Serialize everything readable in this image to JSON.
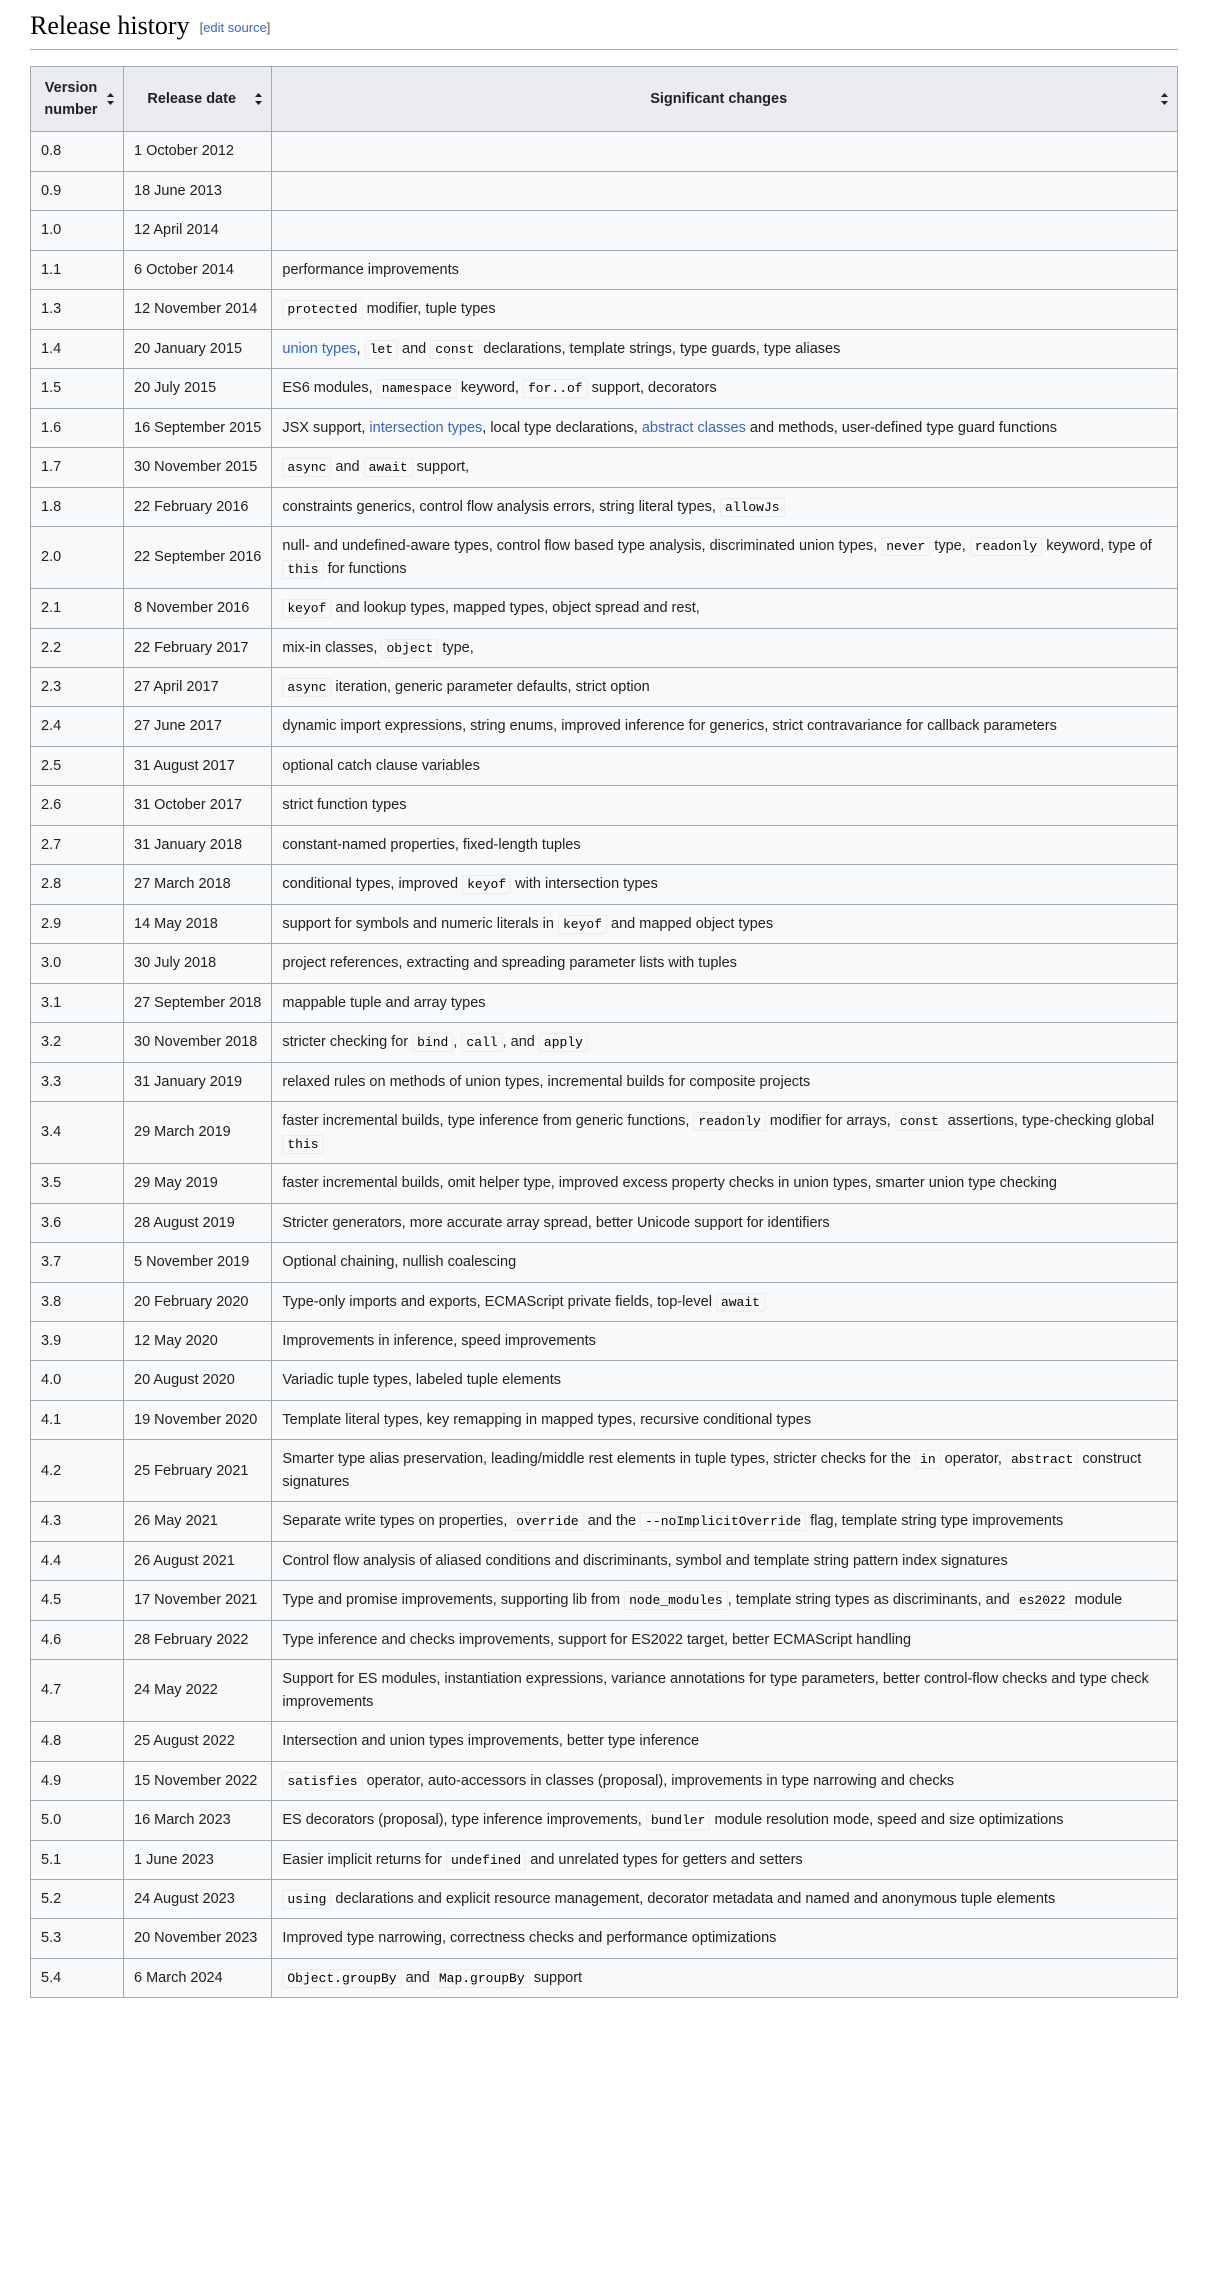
{
  "section": {
    "title": "Release history",
    "edit_open_bracket": "[",
    "edit_label": "edit source",
    "edit_close_bracket": "]"
  },
  "colors": {
    "link": "#3366cc",
    "header_bg": "#eaecf0",
    "table_bg": "#f8f9fa",
    "border": "#a2a9b1",
    "text": "#202122"
  },
  "table": {
    "columns": [
      {
        "label": "Version number",
        "sortable": true,
        "icon": "sort-updown-icon"
      },
      {
        "label": "Release date",
        "sortable": true,
        "icon": "sort-updown-icon"
      },
      {
        "label": "Significant changes",
        "sortable": true,
        "icon": "sort-updown-icon"
      }
    ],
    "rows": [
      {
        "version": "0.8",
        "date": "1 October 2012",
        "changes": []
      },
      {
        "version": "0.9",
        "date": "18 June 2013",
        "changes": []
      },
      {
        "version": "1.0",
        "date": "12 April 2014",
        "changes": []
      },
      {
        "version": "1.1",
        "date": "6 October 2014",
        "changes": [
          {
            "t": "text",
            "v": "performance improvements"
          }
        ]
      },
      {
        "version": "1.3",
        "date": "12 November 2014",
        "changes": [
          {
            "t": "code",
            "v": "protected"
          },
          {
            "t": "text",
            "v": " modifier, tuple types"
          }
        ]
      },
      {
        "version": "1.4",
        "date": "20 January 2015",
        "changes": [
          {
            "t": "link",
            "v": "union types"
          },
          {
            "t": "text",
            "v": ", "
          },
          {
            "t": "code",
            "v": "let"
          },
          {
            "t": "text",
            "v": " and "
          },
          {
            "t": "code",
            "v": "const"
          },
          {
            "t": "text",
            "v": " declarations, template strings, type guards, type aliases"
          }
        ]
      },
      {
        "version": "1.5",
        "date": "20 July 2015",
        "changes": [
          {
            "t": "text",
            "v": "ES6 modules, "
          },
          {
            "t": "code",
            "v": "namespace"
          },
          {
            "t": "text",
            "v": " keyword, "
          },
          {
            "t": "code",
            "v": "for..of"
          },
          {
            "t": "text",
            "v": " support, decorators"
          }
        ]
      },
      {
        "version": "1.6",
        "date": "16 September 2015",
        "changes": [
          {
            "t": "text",
            "v": "JSX support, "
          },
          {
            "t": "link",
            "v": "intersection types"
          },
          {
            "t": "text",
            "v": ", local type declarations, "
          },
          {
            "t": "link",
            "v": "abstract classes"
          },
          {
            "t": "text",
            "v": " and methods, user-defined type guard functions"
          }
        ]
      },
      {
        "version": "1.7",
        "date": "30 November 2015",
        "changes": [
          {
            "t": "code",
            "v": "async"
          },
          {
            "t": "text",
            "v": " and "
          },
          {
            "t": "code",
            "v": "await"
          },
          {
            "t": "text",
            "v": " support,"
          }
        ]
      },
      {
        "version": "1.8",
        "date": "22 February 2016",
        "changes": [
          {
            "t": "text",
            "v": "constraints generics, control flow analysis errors, string literal types, "
          },
          {
            "t": "code",
            "v": "allowJs"
          }
        ]
      },
      {
        "version": "2.0",
        "date": "22 September 2016",
        "changes": [
          {
            "t": "text",
            "v": "null- and undefined-aware types, control flow based type analysis, discriminated union types, "
          },
          {
            "t": "code",
            "v": "never"
          },
          {
            "t": "text",
            "v": " type, "
          },
          {
            "t": "code",
            "v": "readonly"
          },
          {
            "t": "text",
            "v": " keyword, type of "
          },
          {
            "t": "code",
            "v": "this"
          },
          {
            "t": "text",
            "v": " for functions"
          }
        ]
      },
      {
        "version": "2.1",
        "date": "8 November 2016",
        "changes": [
          {
            "t": "code",
            "v": "keyof"
          },
          {
            "t": "text",
            "v": " and lookup types, mapped types, object spread and rest,"
          }
        ]
      },
      {
        "version": "2.2",
        "date": "22 February 2017",
        "changes": [
          {
            "t": "text",
            "v": "mix-in classes, "
          },
          {
            "t": "code",
            "v": "object"
          },
          {
            "t": "text",
            "v": " type,"
          }
        ]
      },
      {
        "version": "2.3",
        "date": "27 April 2017",
        "changes": [
          {
            "t": "code",
            "v": "async"
          },
          {
            "t": "text",
            "v": " iteration, generic parameter defaults, strict option"
          }
        ]
      },
      {
        "version": "2.4",
        "date": "27 June 2017",
        "changes": [
          {
            "t": "text",
            "v": "dynamic import expressions, string enums, improved inference for generics, strict contravariance for callback parameters"
          }
        ]
      },
      {
        "version": "2.5",
        "date": "31 August 2017",
        "changes": [
          {
            "t": "text",
            "v": "optional catch clause variables"
          }
        ]
      },
      {
        "version": "2.6",
        "date": "31 October 2017",
        "changes": [
          {
            "t": "text",
            "v": "strict function types"
          }
        ]
      },
      {
        "version": "2.7",
        "date": "31 January 2018",
        "changes": [
          {
            "t": "text",
            "v": "constant-named properties, fixed-length tuples"
          }
        ]
      },
      {
        "version": "2.8",
        "date": "27 March 2018",
        "changes": [
          {
            "t": "text",
            "v": "conditional types, improved "
          },
          {
            "t": "code",
            "v": "keyof"
          },
          {
            "t": "text",
            "v": " with intersection types"
          }
        ]
      },
      {
        "version": "2.9",
        "date": "14 May 2018",
        "changes": [
          {
            "t": "text",
            "v": "support for symbols and numeric literals in "
          },
          {
            "t": "code",
            "v": "keyof"
          },
          {
            "t": "text",
            "v": " and mapped object types"
          }
        ]
      },
      {
        "version": "3.0",
        "date": "30 July 2018",
        "changes": [
          {
            "t": "text",
            "v": "project references, extracting and spreading parameter lists with tuples"
          }
        ]
      },
      {
        "version": "3.1",
        "date": "27 September 2018",
        "changes": [
          {
            "t": "text",
            "v": "mappable tuple and array types"
          }
        ]
      },
      {
        "version": "3.2",
        "date": "30 November 2018",
        "changes": [
          {
            "t": "text",
            "v": "stricter checking for "
          },
          {
            "t": "code",
            "v": "bind"
          },
          {
            "t": "text",
            "v": ", "
          },
          {
            "t": "code",
            "v": "call"
          },
          {
            "t": "text",
            "v": ", and "
          },
          {
            "t": "code",
            "v": "apply"
          }
        ]
      },
      {
        "version": "3.3",
        "date": "31 January 2019",
        "changes": [
          {
            "t": "text",
            "v": "relaxed rules on methods of union types, incremental builds for composite projects"
          }
        ]
      },
      {
        "version": "3.4",
        "date": "29 March 2019",
        "changes": [
          {
            "t": "text",
            "v": "faster incremental builds, type inference from generic functions, "
          },
          {
            "t": "code",
            "v": "readonly"
          },
          {
            "t": "text",
            "v": " modifier for arrays, "
          },
          {
            "t": "code",
            "v": "const"
          },
          {
            "t": "text",
            "v": " assertions, type-checking global "
          },
          {
            "t": "code",
            "v": "this"
          }
        ]
      },
      {
        "version": "3.5",
        "date": "29 May 2019",
        "changes": [
          {
            "t": "text",
            "v": "faster incremental builds, omit helper type, improved excess property checks in union types, smarter union type checking"
          }
        ]
      },
      {
        "version": "3.6",
        "date": "28 August 2019",
        "changes": [
          {
            "t": "text",
            "v": "Stricter generators, more accurate array spread, better Unicode support for identifiers"
          }
        ]
      },
      {
        "version": "3.7",
        "date": "5 November 2019",
        "changes": [
          {
            "t": "text",
            "v": "Optional chaining, nullish coalescing"
          }
        ]
      },
      {
        "version": "3.8",
        "date": "20 February 2020",
        "changes": [
          {
            "t": "text",
            "v": "Type-only imports and exports, ECMAScript private fields, top-level "
          },
          {
            "t": "code",
            "v": "await"
          }
        ]
      },
      {
        "version": "3.9",
        "date": "12 May 2020",
        "changes": [
          {
            "t": "text",
            "v": "Improvements in inference, speed improvements"
          }
        ]
      },
      {
        "version": "4.0",
        "date": "20 August 2020",
        "changes": [
          {
            "t": "text",
            "v": "Variadic tuple types, labeled tuple elements"
          }
        ]
      },
      {
        "version": "4.1",
        "date": "19 November 2020",
        "changes": [
          {
            "t": "text",
            "v": "Template literal types, key remapping in mapped types, recursive conditional types"
          }
        ]
      },
      {
        "version": "4.2",
        "date": "25 February 2021",
        "changes": [
          {
            "t": "text",
            "v": "Smarter type alias preservation, leading/middle rest elements in tuple types, stricter checks for the "
          },
          {
            "t": "code",
            "v": "in"
          },
          {
            "t": "text",
            "v": " operator, "
          },
          {
            "t": "code",
            "v": "abstract"
          },
          {
            "t": "text",
            "v": " construct signatures"
          }
        ]
      },
      {
        "version": "4.3",
        "date": "26 May 2021",
        "changes": [
          {
            "t": "text",
            "v": "Separate write types on properties, "
          },
          {
            "t": "code",
            "v": "override"
          },
          {
            "t": "text",
            "v": " and the "
          },
          {
            "t": "code",
            "v": "--noImplicitOverride"
          },
          {
            "t": "text",
            "v": " flag, template string type improvements"
          }
        ]
      },
      {
        "version": "4.4",
        "date": "26 August 2021",
        "changes": [
          {
            "t": "text",
            "v": "Control flow analysis of aliased conditions and discriminants, symbol and template string pattern index signatures"
          }
        ]
      },
      {
        "version": "4.5",
        "date": "17 November 2021",
        "changes": [
          {
            "t": "text",
            "v": "Type and promise improvements, supporting lib from "
          },
          {
            "t": "code",
            "v": "node_modules"
          },
          {
            "t": "text",
            "v": ", template string types as discriminants, and "
          },
          {
            "t": "code",
            "v": "es2022"
          },
          {
            "t": "text",
            "v": " module"
          }
        ]
      },
      {
        "version": "4.6",
        "date": "28 February 2022",
        "changes": [
          {
            "t": "text",
            "v": "Type inference and checks improvements, support for ES2022 target, better ECMAScript handling"
          }
        ]
      },
      {
        "version": "4.7",
        "date": "24 May 2022",
        "changes": [
          {
            "t": "text",
            "v": "Support for ES modules, instantiation expressions, variance annotations for type parameters, better control-flow checks and type check improvements"
          }
        ]
      },
      {
        "version": "4.8",
        "date": "25 August 2022",
        "changes": [
          {
            "t": "text",
            "v": "Intersection and union types improvements, better type inference"
          }
        ]
      },
      {
        "version": "4.9",
        "date": "15 November 2022",
        "changes": [
          {
            "t": "code",
            "v": "satisfies"
          },
          {
            "t": "text",
            "v": " operator, auto-accessors in classes (proposal), improvements in type narrowing and checks"
          }
        ]
      },
      {
        "version": "5.0",
        "date": "16 March 2023",
        "changes": [
          {
            "t": "text",
            "v": "ES decorators (proposal), type inference improvements, "
          },
          {
            "t": "code",
            "v": "bundler"
          },
          {
            "t": "text",
            "v": " module resolution mode, speed and size optimizations"
          }
        ]
      },
      {
        "version": "5.1",
        "date": "1 June 2023",
        "changes": [
          {
            "t": "text",
            "v": "Easier implicit returns for "
          },
          {
            "t": "code",
            "v": "undefined"
          },
          {
            "t": "text",
            "v": " and unrelated types for getters and setters"
          }
        ]
      },
      {
        "version": "5.2",
        "date": "24 August 2023",
        "changes": [
          {
            "t": "code",
            "v": "using"
          },
          {
            "t": "text",
            "v": " declarations and explicit resource management, decorator metadata and named and anonymous tuple elements"
          }
        ]
      },
      {
        "version": "5.3",
        "date": "20 November 2023",
        "changes": [
          {
            "t": "text",
            "v": "Improved type narrowing, correctness checks and performance optimizations"
          }
        ]
      },
      {
        "version": "5.4",
        "date": "6 March 2024",
        "changes": [
          {
            "t": "code",
            "v": "Object.groupBy"
          },
          {
            "t": "text",
            "v": " and "
          },
          {
            "t": "code",
            "v": "Map.groupBy"
          },
          {
            "t": "text",
            "v": " support"
          }
        ]
      }
    ]
  }
}
